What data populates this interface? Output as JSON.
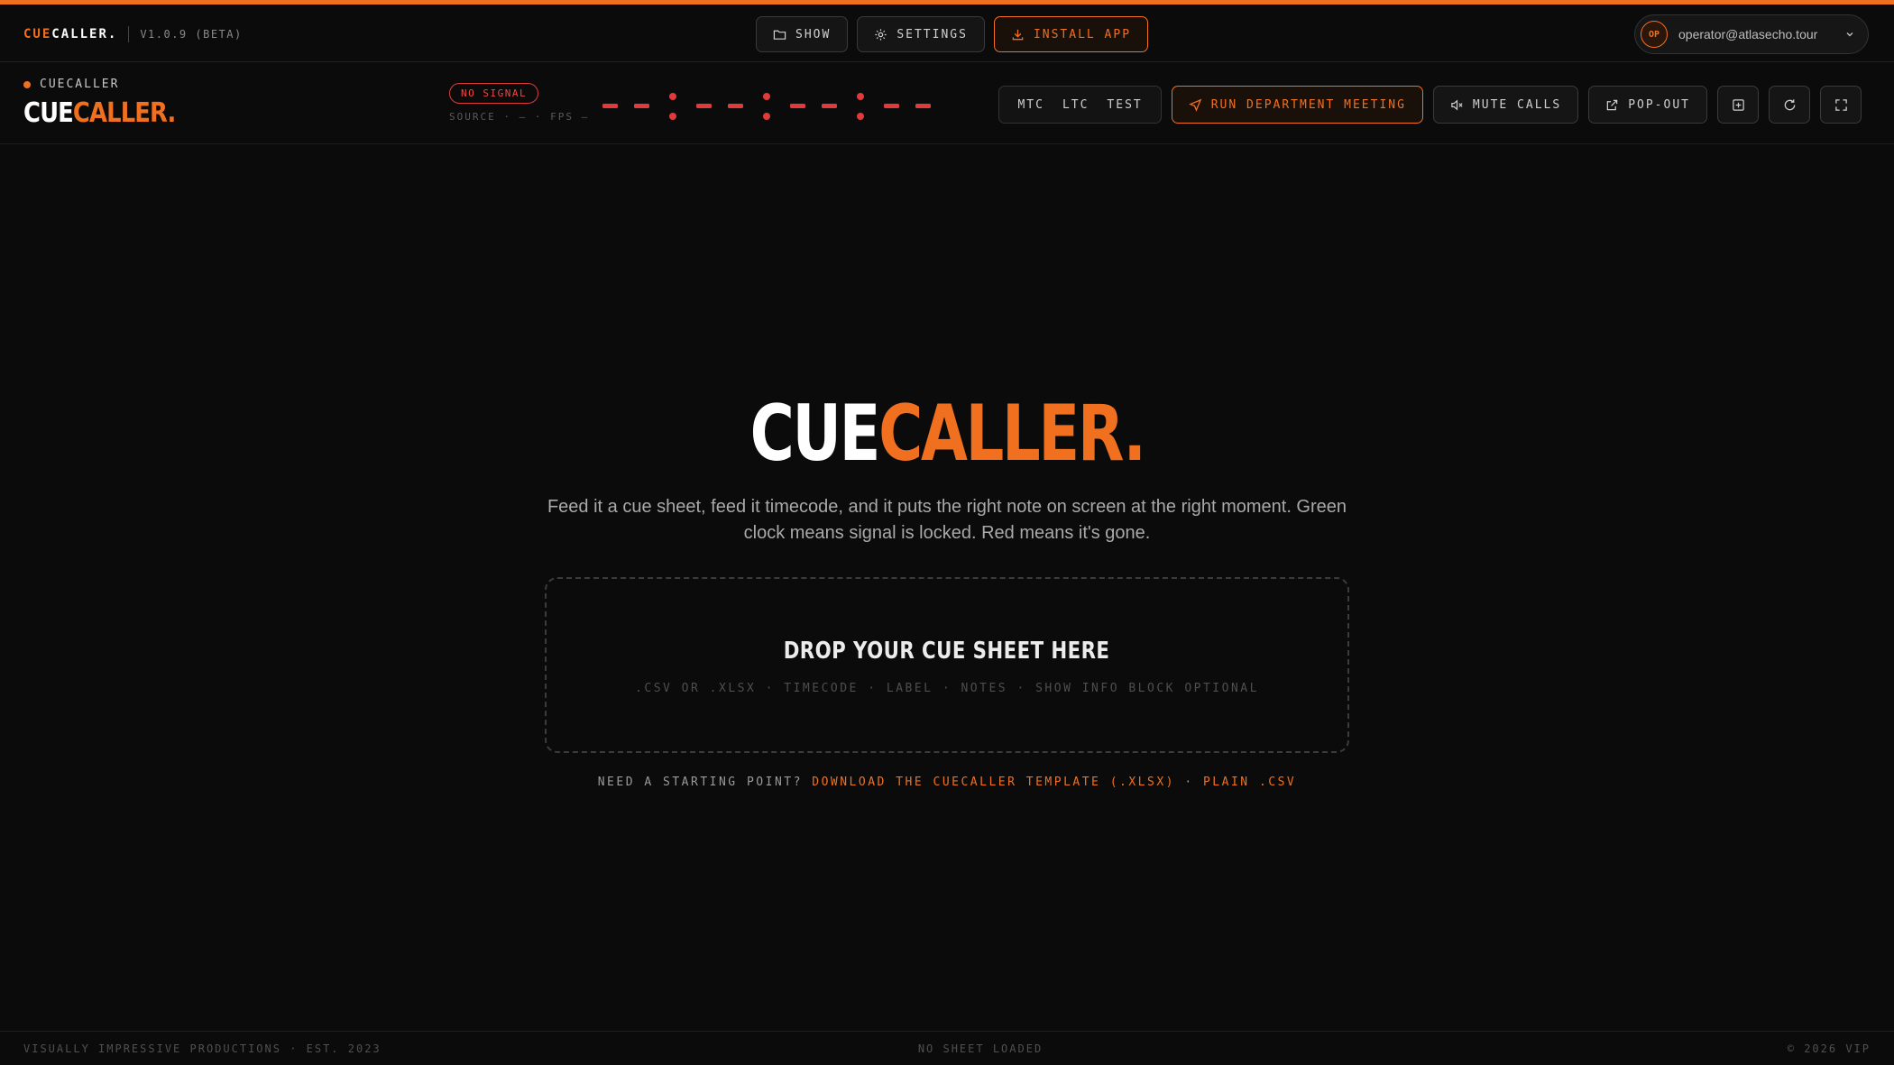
{
  "topbar": {
    "brand_part1": "CUE",
    "brand_part2": "CALLER.",
    "version": "V1.0.9 (BETA)",
    "nav": {
      "show_label": "SHOW",
      "settings_label": "SETTINGS",
      "install_label": "INSTALL APP"
    },
    "user": {
      "initials": "OP",
      "email": "operator@atlasecho.tour"
    }
  },
  "app_header": {
    "app_label": "CUECALLER",
    "logo_part1": "CUE",
    "logo_part2": "CALLER.",
    "signal_badge": "NO SIGNAL",
    "signal_source": "SOURCE · — · FPS —",
    "timecode_display": "--:--:--:--",
    "sources": {
      "mtc": "MTC",
      "ltc": "LTC",
      "test": "TEST"
    },
    "run_meeting_label": "RUN DEPARTMENT MEETING",
    "mute_label": "MUTE CALLS",
    "popout_label": "POP-OUT"
  },
  "hero": {
    "title_part1": "CUE",
    "title_part2": "CALLER.",
    "description": "Feed it a cue sheet, feed it timecode, and it puts the right note on screen at the right moment. Green clock means signal is locked. Red means it's gone."
  },
  "dropzone": {
    "title": "DROP YOUR CUE SHEET HERE",
    "subtitle": ".CSV OR .XLSX · TIMECODE · LABEL · NOTES · SHOW INFO BLOCK OPTIONAL"
  },
  "starter": {
    "question": "NEED A STARTING POINT?",
    "template_link": "DOWNLOAD THE CUECALLER TEMPLATE (.XLSX)",
    "separator": "·",
    "csv_link": "PLAIN .CSV"
  },
  "footer": {
    "left": "VISUALLY IMPRESSIVE PRODUCTIONS · EST. 2023",
    "center": "NO SHEET LOADED",
    "right": "© 2026 VIP"
  },
  "colors": {
    "accent": "#f07020",
    "signal_red": "#e23a3a",
    "background": "#0b0b0b"
  }
}
